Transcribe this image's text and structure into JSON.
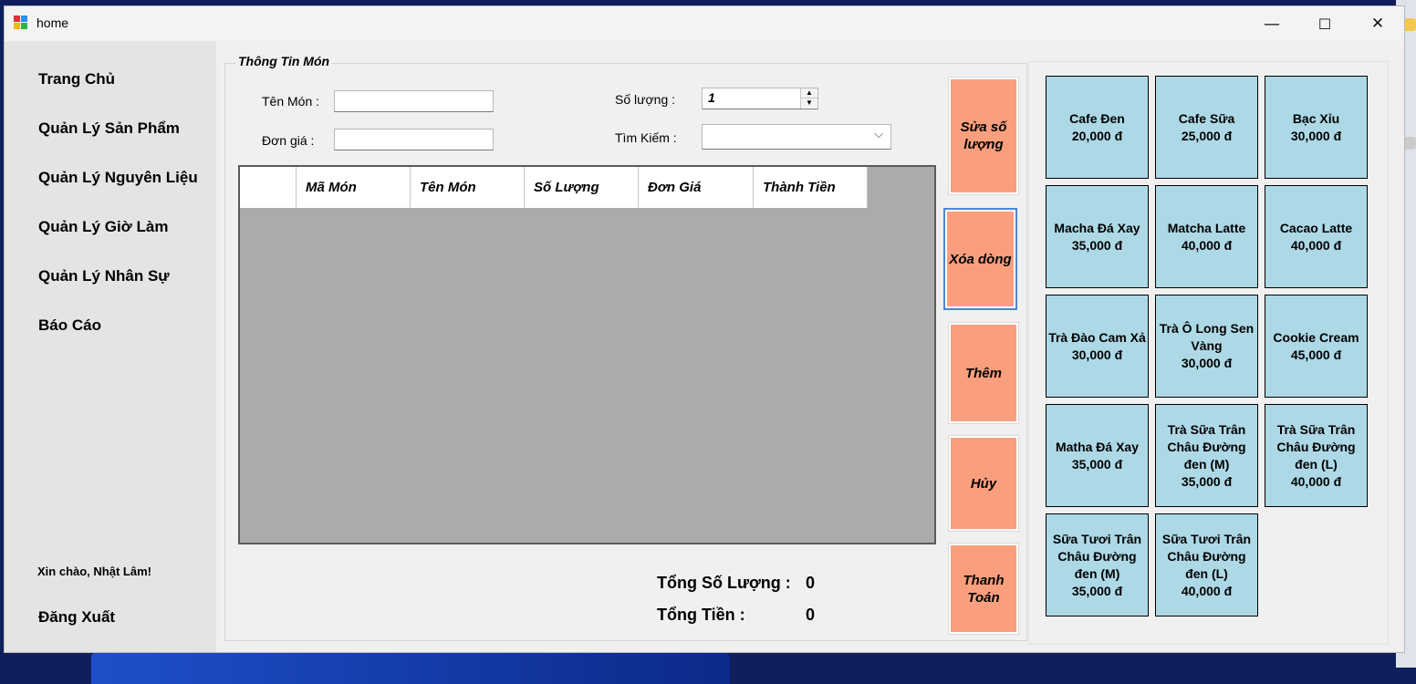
{
  "window": {
    "title": "home",
    "icon": "app-window-icon",
    "minimize": "—",
    "maximize": "☐",
    "close": "✕"
  },
  "sidebar": {
    "items": [
      {
        "label": "Trang Chủ"
      },
      {
        "label": "Quản Lý Sản Phẩm"
      },
      {
        "label": "Quản Lý Nguyên Liệu"
      },
      {
        "label": "Quản Lý Giờ Làm"
      },
      {
        "label": "Quản Lý Nhân Sự"
      },
      {
        "label": "Báo Cáo"
      }
    ],
    "greeting": "Xin chào, Nhật Lâm!",
    "logout": "Đăng Xuất"
  },
  "info": {
    "caption": "Thông Tin Món",
    "name_label": "Tên Món :",
    "name_value": "",
    "price_label": "Đơn giá :",
    "price_value": "",
    "qty_label": "Số lượng :",
    "qty_value": "1",
    "search_label": "Tìm Kiếm :",
    "search_value": ""
  },
  "grid": {
    "columns": [
      "",
      "Mã Món",
      "Tên Món",
      "Số Lượng",
      "Đơn Giá",
      "Thành Tiền"
    ],
    "rows": []
  },
  "totals": {
    "qty_label": "Tổng Số Lượng :",
    "qty_value": "0",
    "money_label": "Tổng Tiền :",
    "money_value": "0"
  },
  "actions": {
    "update_qty": "Sửa số lượng",
    "delete_row": "Xóa dòng",
    "add": "Thêm",
    "cancel": "Hủy",
    "checkout": "Thanh Toán"
  },
  "menu_items": [
    {
      "name": "Cafe Đen",
      "price": "20,000 đ"
    },
    {
      "name": "Cafe Sữa",
      "price": "25,000 đ"
    },
    {
      "name": "Bạc Xỉu",
      "price": "30,000 đ"
    },
    {
      "name": "Macha Đá Xay",
      "price": "35,000 đ"
    },
    {
      "name": "Matcha Latte",
      "price": "40,000 đ"
    },
    {
      "name": "Cacao Latte",
      "price": "40,000 đ"
    },
    {
      "name": "Trà Đào Cam Xả",
      "price": "30,000 đ"
    },
    {
      "name": "Trà Ô Long Sen Vàng",
      "price": "30,000 đ"
    },
    {
      "name": "Cookie Cream",
      "price": "45,000 đ"
    },
    {
      "name": "Matha Đá Xay",
      "price": "35,000 đ"
    },
    {
      "name": "Trà Sữa Trân Châu Đường đen (M)",
      "price": "35,000 đ"
    },
    {
      "name": "Trà Sữa Trân Châu Đường đen (L)",
      "price": "40,000 đ"
    },
    {
      "name": "Sữa Tươi Trân Châu Đường đen (M)",
      "price": "35,000 đ"
    },
    {
      "name": "Sữa Tươi Trân Châu Đường đen (L)",
      "price": "40,000 đ"
    }
  ],
  "colors": {
    "action_button": "#fa9f7d",
    "menu_tile": "#add8e6",
    "grid_bg": "#ababab",
    "sidebar": "#e4e4e4"
  }
}
